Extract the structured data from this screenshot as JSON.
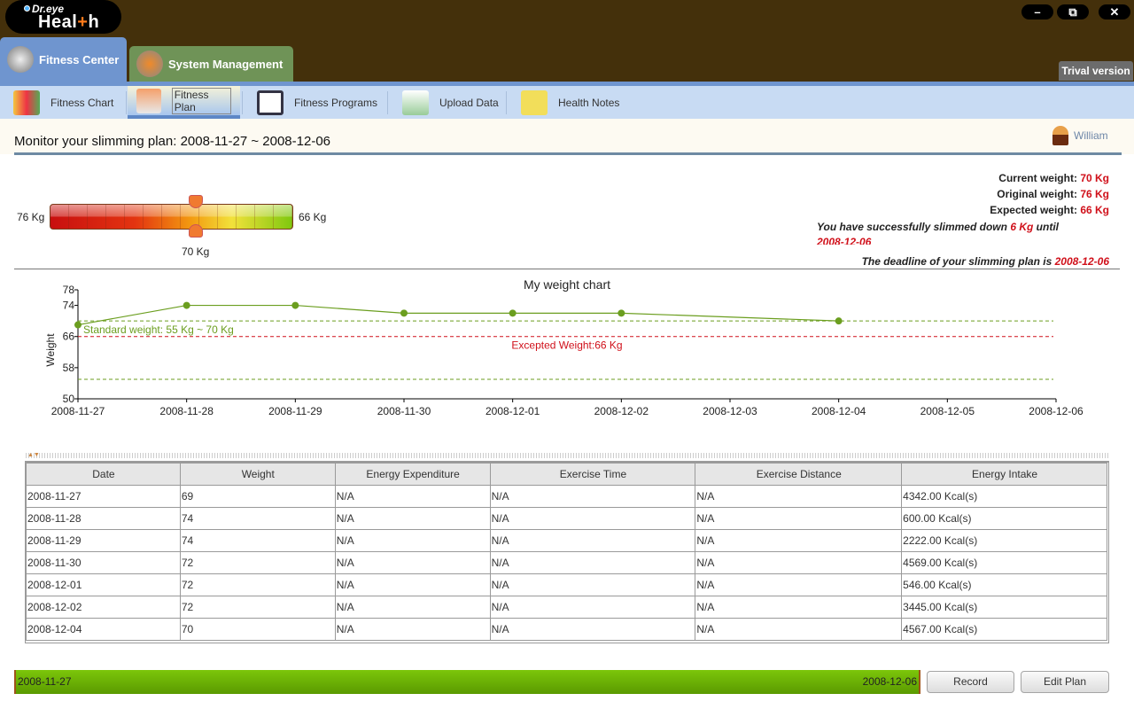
{
  "app": {
    "logo_top": "Dr.eye",
    "logo_bottom": "Health",
    "trial": "Trival version",
    "window_buttons": [
      "minimize",
      "restore",
      "close"
    ]
  },
  "main_tabs": [
    {
      "label": "Fitness Center",
      "active": true
    },
    {
      "label": "System Management",
      "active": false
    }
  ],
  "sub_tabs": [
    {
      "label": "Fitness Chart"
    },
    {
      "label": "Fitness Plan",
      "active": true
    },
    {
      "label": "Fitness Programs"
    },
    {
      "label": "Upload Data"
    },
    {
      "label": "Health Notes"
    }
  ],
  "page": {
    "title": "Monitor your slimming plan: 2008-11-27 ~ 2008-12-06",
    "user": "William"
  },
  "gauge": {
    "start_label": "76 Kg",
    "end_label": "66 Kg",
    "current_label": "70 Kg",
    "start": 76,
    "end": 66,
    "current": 70
  },
  "stats": {
    "current_label": "Current weight:",
    "current": "70 Kg",
    "original_label": "Original weight:",
    "original": "76 Kg",
    "expected_label": "Expected weight:",
    "expected": "66 Kg",
    "success_pre": "You have successfully slimmed down",
    "success_amount": "6 Kg",
    "success_post": "until",
    "success_date": "2008-12-06",
    "deadline_label": "The deadline of your slimming plan is",
    "deadline": "2008-12-06"
  },
  "chart_data": {
    "type": "line",
    "title": "My weight chart",
    "ylabel": "Weight",
    "xlabel": "",
    "ylim": [
      50,
      78
    ],
    "yticks": [
      50,
      58,
      66,
      74,
      78
    ],
    "x": [
      "2008-11-27",
      "2008-11-28",
      "2008-11-29",
      "2008-11-30",
      "2008-12-01",
      "2008-12-02",
      "2008-12-03",
      "2008-12-04",
      "2008-12-05",
      "2008-12-06"
    ],
    "points": [
      {
        "x": "2008-11-27",
        "y": 69
      },
      {
        "x": "2008-11-28",
        "y": 74
      },
      {
        "x": "2008-11-29",
        "y": 74
      },
      {
        "x": "2008-11-30",
        "y": 72
      },
      {
        "x": "2008-12-01",
        "y": 72
      },
      {
        "x": "2008-12-02",
        "y": 72
      },
      {
        "x": "2008-12-04",
        "y": 70
      }
    ],
    "reference_lines": [
      {
        "label": "Standard weight: 55 Kg ~ 70 Kg",
        "values": [
          55,
          70
        ],
        "color": "#6b9e1f"
      },
      {
        "label": "Excepted Weight:66 Kg",
        "values": [
          66
        ],
        "color": "#d0101a"
      }
    ],
    "series_color": "#6b9e1f",
    "grid": false
  },
  "table": {
    "columns": [
      "Date",
      "Weight",
      "Energy Expenditure",
      "Exercise Time",
      "Exercise Distance",
      "Energy Intake"
    ],
    "rows": [
      [
        "2008-11-27",
        "69",
        "N/A",
        "N/A",
        "N/A",
        "4342.00 Kcal(s)"
      ],
      [
        "2008-11-28",
        "74",
        "N/A",
        "N/A",
        "N/A",
        "600.00 Kcal(s)"
      ],
      [
        "2008-11-29",
        "74",
        "N/A",
        "N/A",
        "N/A",
        "2222.00 Kcal(s)"
      ],
      [
        "2008-11-30",
        "72",
        "N/A",
        "N/A",
        "N/A",
        "4569.00 Kcal(s)"
      ],
      [
        "2008-12-01",
        "72",
        "N/A",
        "N/A",
        "N/A",
        "546.00 Kcal(s)"
      ],
      [
        "2008-12-02",
        "72",
        "N/A",
        "N/A",
        "N/A",
        "3445.00 Kcal(s)"
      ],
      [
        "2008-12-04",
        "70",
        "N/A",
        "N/A",
        "N/A",
        "4567.00 Kcal(s)"
      ]
    ]
  },
  "timeline": {
    "start": "2008-11-27",
    "end": "2008-12-06"
  },
  "buttons": {
    "record": "Record",
    "edit_plan": "Edit Plan"
  }
}
